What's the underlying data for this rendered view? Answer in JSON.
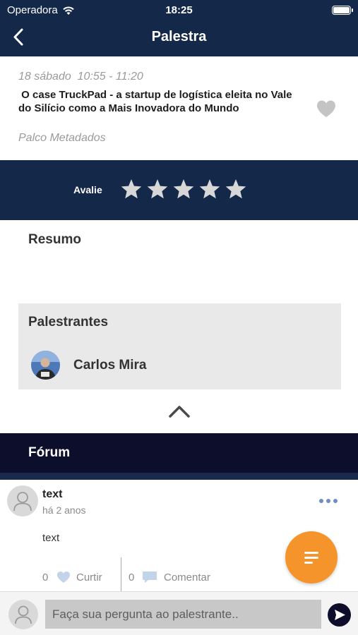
{
  "status_bar": {
    "carrier": "Operadora",
    "time": "18:25"
  },
  "navbar": {
    "title": "Palestra"
  },
  "talk": {
    "datetime": "18 sábado  10:55 - 11:20",
    "title": " O case TruckPad - a startup de logística eleita no Vale do Silício como a Mais Inovadora do Mundo",
    "venue": "Palco Metadados"
  },
  "rating": {
    "label": "Avalie",
    "max_stars": 5,
    "selected": 0
  },
  "summary": {
    "heading": "Resumo"
  },
  "speakers": {
    "heading": "Palestrantes",
    "items": [
      {
        "name": "Carlos Mira"
      }
    ]
  },
  "forum": {
    "heading": "Fórum",
    "posts": [
      {
        "author": "text",
        "ago": "há 2 anos",
        "body": "text",
        "likes": "0",
        "like_label": "Curtir",
        "comments": "0",
        "comment_label": "Comentar"
      }
    ]
  },
  "composer": {
    "placeholder": "Faça sua pergunta ao palestrante.."
  },
  "colors": {
    "navy": "#142849",
    "forum_bar": "#0d0e2c",
    "accent_orange": "#f5942a",
    "panel_gray": "#e9e9e9"
  }
}
